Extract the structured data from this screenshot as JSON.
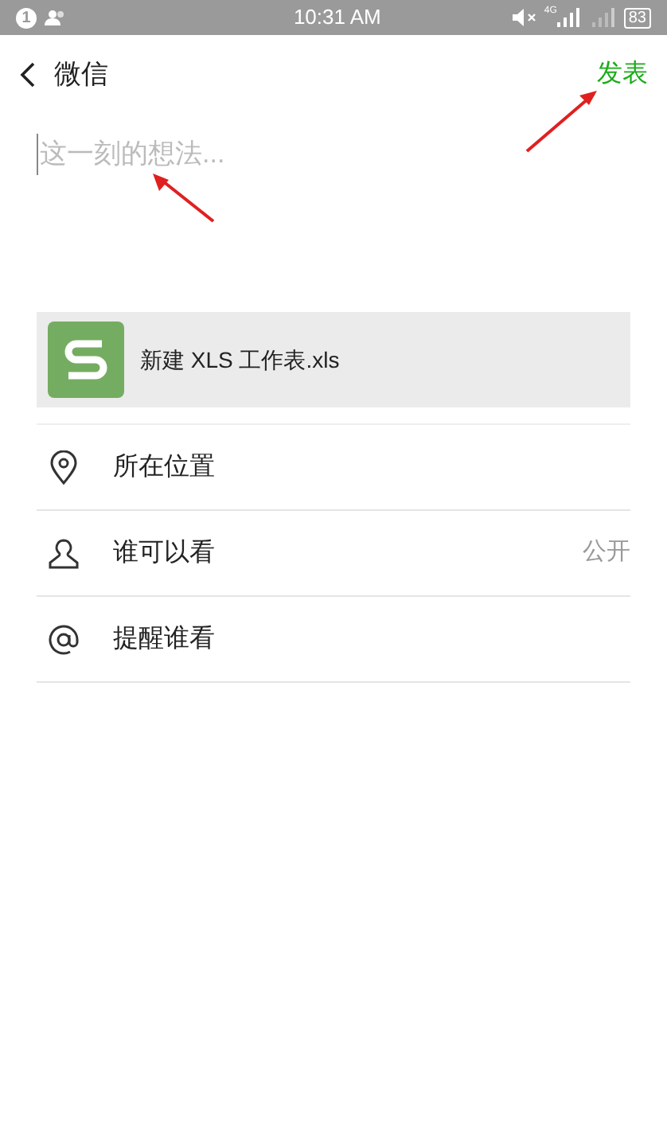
{
  "status_bar": {
    "notification_count": "1",
    "time": "10:31 AM",
    "network": "4G",
    "battery": "83"
  },
  "header": {
    "back_label": "微信",
    "action": "发表"
  },
  "post_field": {
    "placeholder": "这一刻的想法..."
  },
  "attachment": {
    "file_name": "新建 XLS 工作表.xls"
  },
  "options": [
    {
      "kind": "location",
      "label": "所在位置"
    },
    {
      "kind": "visibility",
      "label": "谁可以看",
      "value": "公开"
    },
    {
      "kind": "mention",
      "label": "提醒谁看"
    }
  ]
}
